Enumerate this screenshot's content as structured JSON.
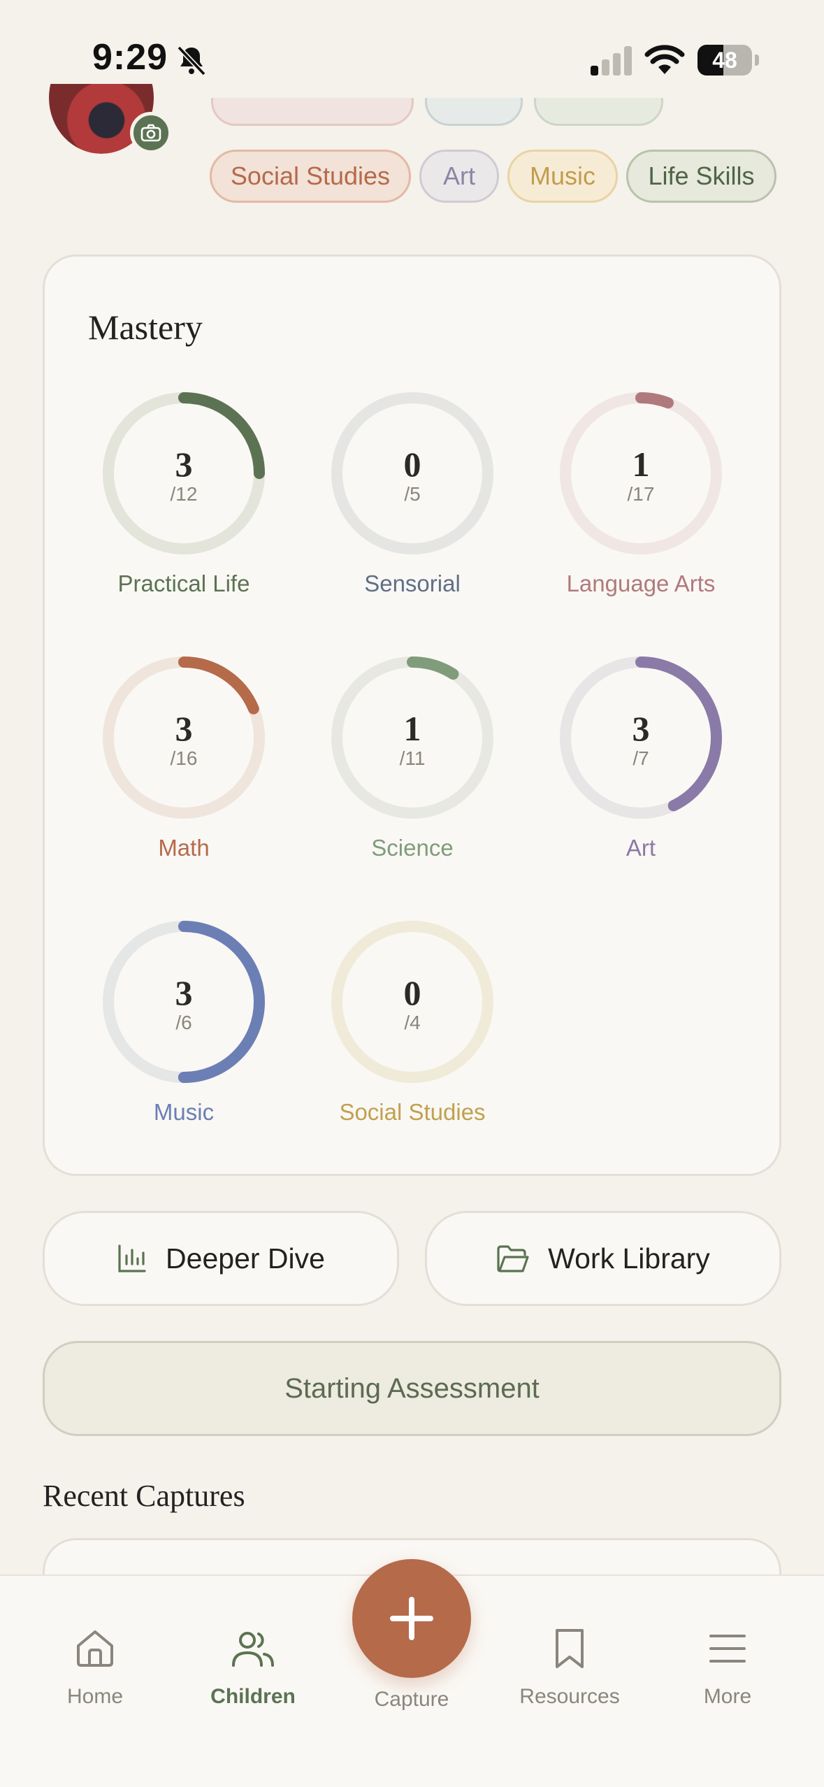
{
  "status_bar": {
    "time": "9:29",
    "battery": "48",
    "battery_level": 0.48
  },
  "subject_chips": [
    {
      "label": "Social Studies",
      "fg": "#b56a4a",
      "bg": "#f2e2d8",
      "border": "#e2b9a5"
    },
    {
      "label": "Art",
      "fg": "#8a86a5",
      "bg": "#ebe8ea",
      "border": "#cfcbd4"
    },
    {
      "label": "Music",
      "fg": "#c29c4e",
      "bg": "#f6ecd6",
      "border": "#e9d3a4"
    },
    {
      "label": "Life Skills",
      "fg": "#4f6447",
      "bg": "#e6e9dc",
      "border": "#b9c3ab"
    }
  ],
  "mastery": {
    "title": "Mastery",
    "items": [
      {
        "label": "Practical Life",
        "value": "3",
        "total": "/12",
        "fraction": 0.25,
        "color": "#5b7352",
        "track": "#e3e4da"
      },
      {
        "label": "Sensorial",
        "value": "0",
        "total": "/5",
        "fraction": 0,
        "color": "#5f6f86",
        "track": "#e5e5e4"
      },
      {
        "label": "Language Arts",
        "value": "1",
        "total": "/17",
        "fraction": 0.0588,
        "color": "#b07a7c",
        "track": "#f0e6e4"
      },
      {
        "label": "Math",
        "value": "3",
        "total": "/16",
        "fraction": 0.1875,
        "color": "#b56a4a",
        "track": "#efe5dd"
      },
      {
        "label": "Science",
        "value": "1",
        "total": "/11",
        "fraction": 0.0909,
        "color": "#7f9c7b",
        "track": "#e8e8e2"
      },
      {
        "label": "Art",
        "value": "3",
        "total": "/7",
        "fraction": 0.4286,
        "color": "#8a7aa8",
        "track": "#e7e5e6"
      },
      {
        "label": "Music",
        "value": "3",
        "total": "/6",
        "fraction": 0.5,
        "color": "#6b7fb5",
        "track": "#e5e6e6"
      },
      {
        "label": "Social Studies",
        "value": "0",
        "total": "/4",
        "fraction": 0,
        "color": "#c1a04f",
        "track": "#f0ead8"
      }
    ]
  },
  "actions": {
    "deeper_dive": "Deeper Dive",
    "work_library": "Work Library",
    "assessment": "Starting Assessment"
  },
  "recent": {
    "title": "Recent Captures"
  },
  "tabs": [
    {
      "label": "Home",
      "icon": "home-icon"
    },
    {
      "label": "Children",
      "icon": "children-icon",
      "active": true
    },
    {
      "label": "Capture",
      "icon": "plus-icon"
    },
    {
      "label": "Resources",
      "icon": "bookmark-icon"
    },
    {
      "label": "More",
      "icon": "menu-icon"
    }
  ]
}
